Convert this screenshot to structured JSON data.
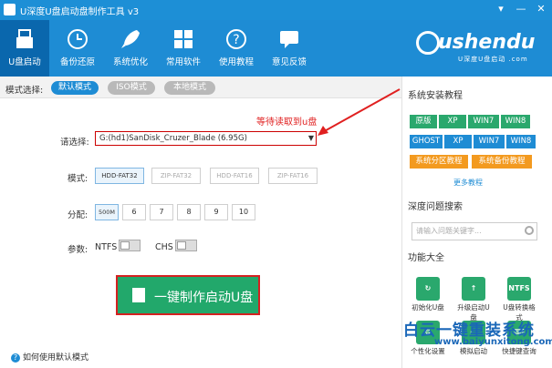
{
  "window": {
    "title": "U深度U盘启动盘制作工具 v3"
  },
  "toolbar": {
    "items": [
      {
        "label": "U盘启动"
      },
      {
        "label": "备份还原"
      },
      {
        "label": "系统优化"
      },
      {
        "label": "常用软件"
      },
      {
        "label": "使用教程"
      },
      {
        "label": "意见反馈"
      }
    ]
  },
  "brand": {
    "name": "ushendu",
    "tagline": "U深度U盘启动 .com"
  },
  "mode": {
    "label": "模式选择:",
    "options": [
      {
        "label": "默认模式"
      },
      {
        "label": "ISO模式"
      },
      {
        "label": "本地模式"
      }
    ]
  },
  "annotation": "等待读取到u盘",
  "select": {
    "label": "请选择:",
    "value": "G:(hd1)SanDisk_Cruzer_Blade (6.95G)"
  },
  "format": {
    "label": "模式:",
    "options": [
      "HDD-FAT32",
      "ZIP-FAT32",
      "HDD-FAT16",
      "ZIP-FAT16"
    ]
  },
  "partition": {
    "label": "分配:",
    "options": [
      "500M",
      "6",
      "7",
      "8",
      "9",
      "10"
    ]
  },
  "params": {
    "label": "参数:",
    "ntfs": "NTFS",
    "chs": "CHS"
  },
  "make_button": {
    "label": "一键制作启动U盘"
  },
  "help": {
    "label": "如何使用默认模式"
  },
  "sidebar": {
    "install_title": "系统安装教程",
    "row1": [
      "原版",
      "XP",
      "WIN7",
      "WIN8"
    ],
    "row2": [
      "GHOST",
      "XP",
      "WIN7",
      "WIN8"
    ],
    "row3": [
      "系统分区教程",
      "系统备份教程"
    ],
    "more": "更多教程",
    "faq_title": "深度问题搜索",
    "search_placeholder": "请输入问题关键字...",
    "func_title": "功能大全",
    "funcs": [
      {
        "label": "初始化U盘",
        "icon": "initialize-icon"
      },
      {
        "label": "升级启动U盘",
        "icon": "upgrade-icon"
      },
      {
        "label": "U盘转换格式",
        "icon": "NTFS"
      },
      {
        "label": "个性化设置"
      },
      {
        "label": "模拟启动"
      },
      {
        "label": "快捷键查询"
      }
    ]
  },
  "watermark": {
    "line1": "白云一键重装系统",
    "line2": "www.baiyunxitong.com"
  }
}
